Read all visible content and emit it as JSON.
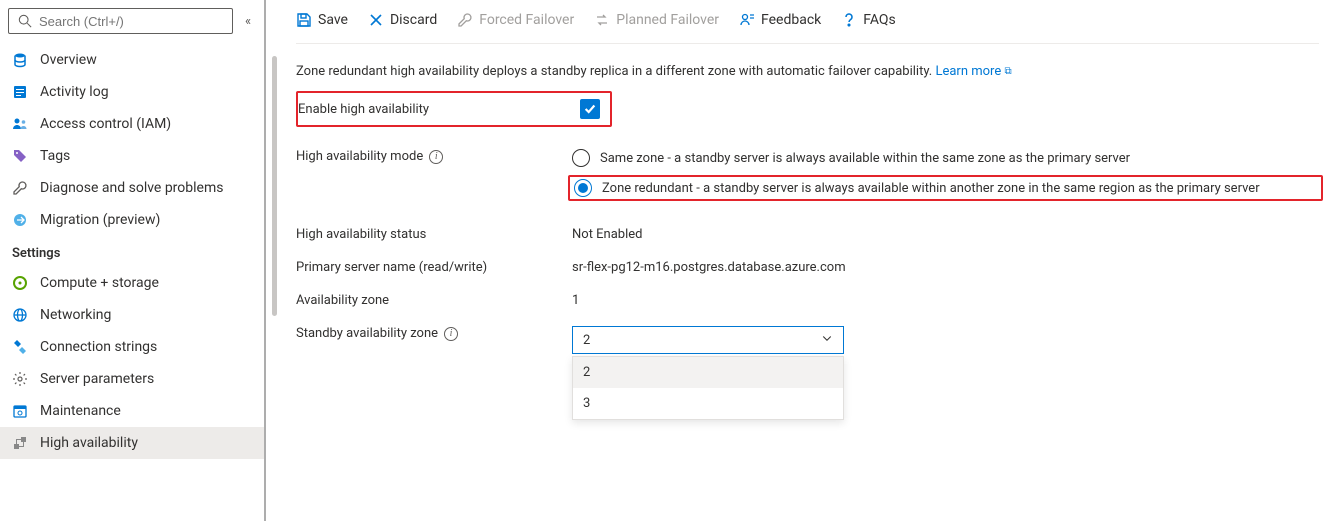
{
  "search": {
    "placeholder": "Search (Ctrl+/)"
  },
  "sidebar": {
    "items": [
      {
        "label": "Overview"
      },
      {
        "label": "Activity log"
      },
      {
        "label": "Access control (IAM)"
      },
      {
        "label": "Tags"
      },
      {
        "label": "Diagnose and solve problems"
      },
      {
        "label": "Migration (preview)"
      }
    ],
    "settings_label": "Settings",
    "settings": [
      {
        "label": "Compute + storage"
      },
      {
        "label": "Networking"
      },
      {
        "label": "Connection strings"
      },
      {
        "label": "Server parameters"
      },
      {
        "label": "Maintenance"
      },
      {
        "label": "High availability"
      }
    ]
  },
  "toolbar": {
    "save": "Save",
    "discard": "Discard",
    "forced": "Forced Failover",
    "planned": "Planned Failover",
    "feedback": "Feedback",
    "faqs": "FAQs"
  },
  "main": {
    "description": "Zone redundant high availability deploys a standby replica in a different zone with automatic failover capability.",
    "learn_more": "Learn more",
    "enable_label": "Enable high availability",
    "mode_label": "High availability mode",
    "mode_options": {
      "same": "Same zone - a standby server is always available within the same zone as the primary server",
      "zone": "Zone redundant - a standby server is always available within another zone in the same region as the primary server"
    },
    "status_label": "High availability status",
    "status_value": "Not Enabled",
    "primary_label": "Primary server name (read/write)",
    "primary_value": "sr-flex-pg12-m16.postgres.database.azure.com",
    "az_label": "Availability zone",
    "az_value": "1",
    "standby_label": "Standby availability zone",
    "standby_selected": "2",
    "standby_options": [
      "2",
      "3"
    ]
  }
}
